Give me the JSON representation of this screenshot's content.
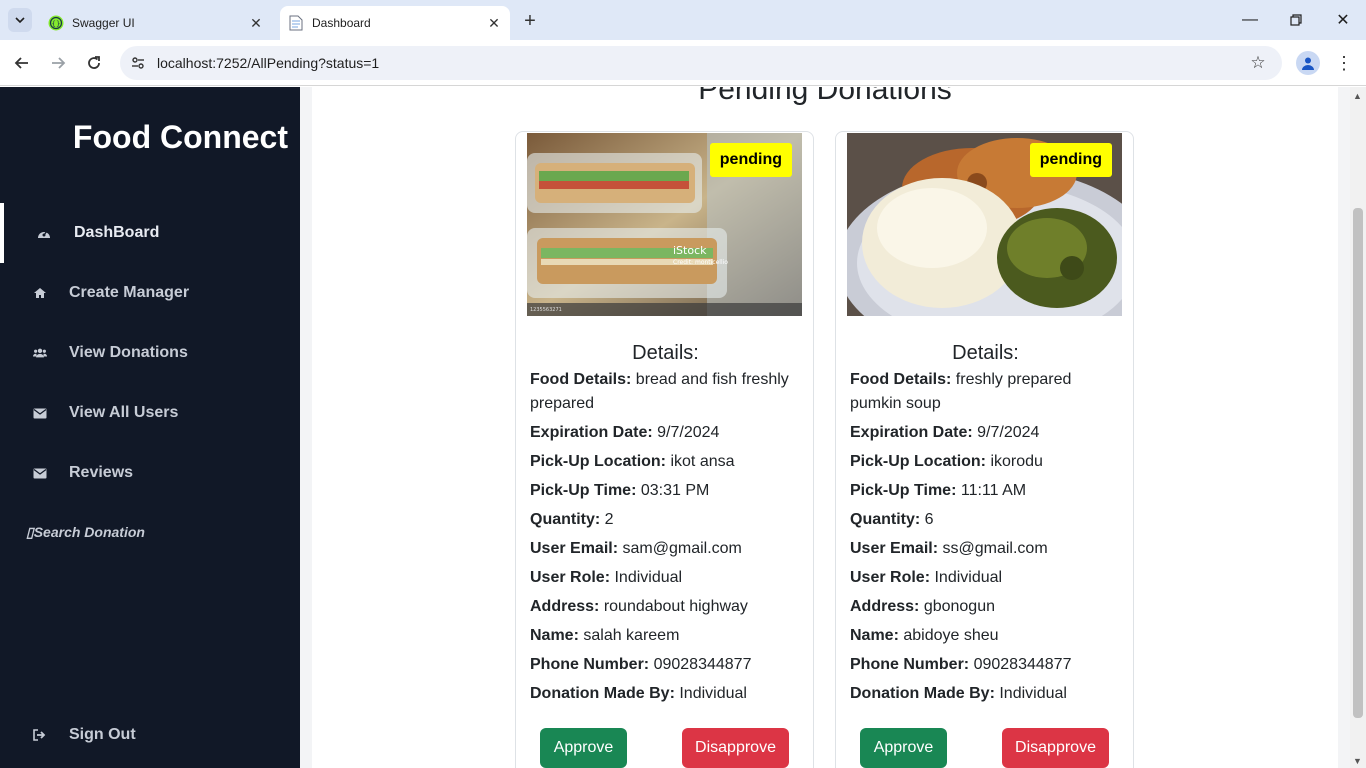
{
  "browser": {
    "tabs": [
      {
        "title": "Swagger UI",
        "active": false
      },
      {
        "title": "Dashboard",
        "active": true
      }
    ],
    "url": "localhost:7252/AllPending?status=1"
  },
  "sidebar": {
    "brand": "Food Connect",
    "items": [
      {
        "label": "DashBoard",
        "icon": "dashboard-icon",
        "active": true
      },
      {
        "label": "Create Manager",
        "icon": "home-icon"
      },
      {
        "label": "View Donations",
        "icon": "users-icon"
      },
      {
        "label": "View All Users",
        "icon": "envelope-icon"
      },
      {
        "label": "Reviews",
        "icon": "envelope-icon"
      }
    ],
    "search_label": "▯Search Donation",
    "signout_label": "Sign Out"
  },
  "main": {
    "title": "Pending Donations",
    "cards": [
      {
        "badge": "pending",
        "details_title": "Details:",
        "image": {
          "watermark": "iStock",
          "credit": "Credit: monticellio",
          "id": "1235563271"
        },
        "fields": [
          {
            "label": "Food Details:",
            "value": "bread and fish freshly prepared"
          },
          {
            "label": "Expiration Date:",
            "value": "9/7/2024"
          },
          {
            "label": "Pick-Up Location:",
            "value": "ikot ansa"
          },
          {
            "label": "Pick-Up Time:",
            "value": "03:31 PM"
          },
          {
            "label": "Quantity:",
            "value": "2"
          },
          {
            "label": "User Email:",
            "value": "sam@gmail.com"
          },
          {
            "label": "User Role:",
            "value": "Individual"
          },
          {
            "label": "Address:",
            "value": "roundabout highway"
          },
          {
            "label": "Name:",
            "value": "salah kareem"
          },
          {
            "label": "Phone Number:",
            "value": "09028344877"
          },
          {
            "label": "Donation Made By:",
            "value": "Individual"
          }
        ],
        "approve_label": "Approve",
        "disapprove_label": "Disapprove"
      },
      {
        "badge": "pending",
        "details_title": "Details:",
        "fields": [
          {
            "label": "Food Details:",
            "value": "freshly prepared pumkin soup"
          },
          {
            "label": "Expiration Date:",
            "value": "9/7/2024"
          },
          {
            "label": "Pick-Up Location:",
            "value": "ikorodu"
          },
          {
            "label": "Pick-Up Time:",
            "value": "11:11 AM"
          },
          {
            "label": "Quantity:",
            "value": "6"
          },
          {
            "label": "User Email:",
            "value": "ss@gmail.com"
          },
          {
            "label": "User Role:",
            "value": "Individual"
          },
          {
            "label": "Address:",
            "value": "gbonogun"
          },
          {
            "label": "Name:",
            "value": "abidoye sheu"
          },
          {
            "label": "Phone Number:",
            "value": "09028344877"
          },
          {
            "label": "Donation Made By:",
            "value": "Individual"
          }
        ],
        "approve_label": "Approve",
        "disapprove_label": "Disapprove"
      }
    ]
  },
  "colors": {
    "sidebar_bg": "#111827",
    "approve": "#198754",
    "disapprove": "#dc3545",
    "badge": "#ffff00"
  }
}
